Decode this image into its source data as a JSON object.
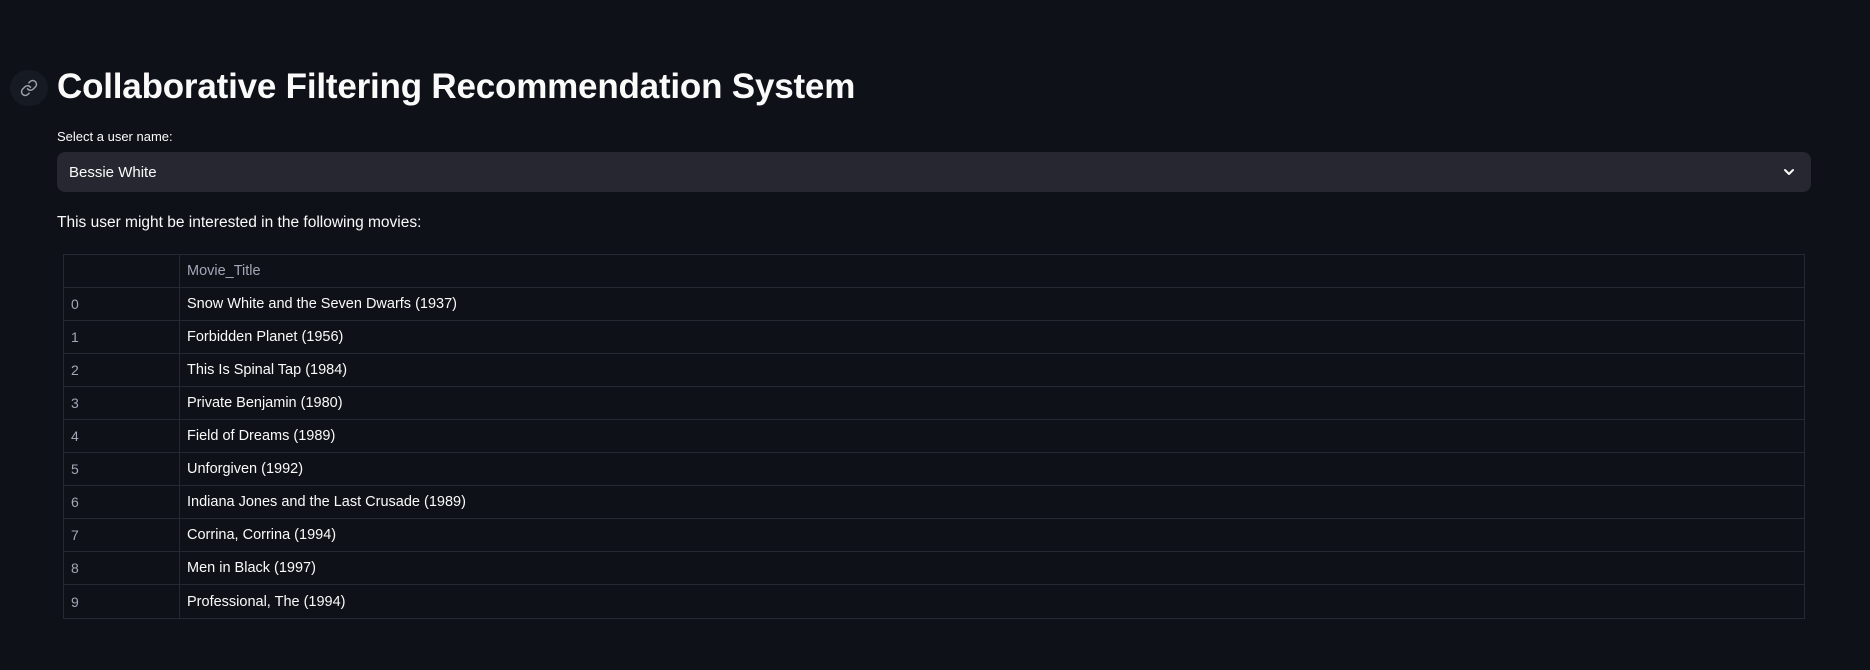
{
  "header": {
    "title": "Collaborative Filtering Recommendation System",
    "anchor_icon": "link-icon"
  },
  "select": {
    "label": "Select a user name:",
    "value": "Bessie White",
    "icon": "chevron-down-icon"
  },
  "info_text": "This user might be interested in the following movies:",
  "table": {
    "columns": [
      "",
      "Movie_Title"
    ],
    "rows": [
      {
        "index": "0",
        "title": "Snow White and the Seven Dwarfs (1937)"
      },
      {
        "index": "1",
        "title": "Forbidden Planet (1956)"
      },
      {
        "index": "2",
        "title": "This Is Spinal Tap (1984)"
      },
      {
        "index": "3",
        "title": "Private Benjamin (1980)"
      },
      {
        "index": "4",
        "title": "Field of Dreams (1989)"
      },
      {
        "index": "5",
        "title": "Unforgiven (1992)"
      },
      {
        "index": "6",
        "title": "Indiana Jones and the Last Crusade (1989)"
      },
      {
        "index": "7",
        "title": "Corrina, Corrina (1994)"
      },
      {
        "index": "8",
        "title": "Men in Black (1997)"
      },
      {
        "index": "9",
        "title": "Professional, The (1994)"
      }
    ]
  },
  "colors": {
    "background": "#0e1117",
    "select_background": "#262730",
    "border": "#262833",
    "text": "#fafafa",
    "muted_text": "#a3a8b8"
  }
}
